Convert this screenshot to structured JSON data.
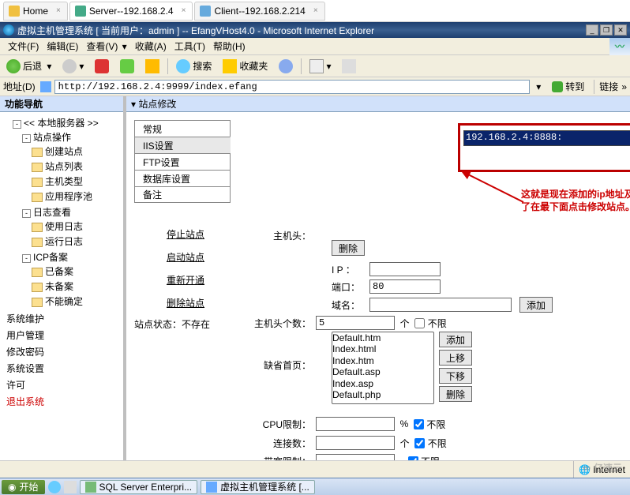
{
  "top_tabs": {
    "home": "Home",
    "server": "Server--192.168.2.4",
    "client": "Client--192.168.2.214"
  },
  "window_title": "虚拟主机管理系统 [ 当前用户：admin ] -- EfangVHost4.0 - Microsoft Internet Explorer",
  "menu": {
    "file": "文件(F)",
    "edit": "编辑(E)",
    "view": "查看(V)",
    "fav": "收藏(A)",
    "tools": "工具(T)",
    "help": "帮助(H)"
  },
  "toolbar": {
    "back": "后退",
    "search": "搜索",
    "fav": "收藏夹"
  },
  "addr": {
    "label": "地址(D)",
    "value": "http://192.168.2.4:9999/index.efang",
    "go": "转到",
    "links": "链接"
  },
  "left": {
    "title": "功能导航",
    "root": "<< 本地服务器 >>",
    "site_ops": "站点操作",
    "create_site": "创建站点",
    "site_list": "站点列表",
    "host_type": "主机类型",
    "app_pool": "应用程序池",
    "log": "日志查看",
    "log_use": "使用日志",
    "log_run": "运行日志",
    "icp": "ICP备案",
    "icp_done": "已备案",
    "icp_undone": "未备案",
    "icp_unknown": "不能确定",
    "sys_maint": "系统维护",
    "user_mgmt": "用户管理",
    "change_pwd": "修改密码",
    "sys_set": "系统设置",
    "license": "许可",
    "logout": "退出系统"
  },
  "right": {
    "title": "站点修改",
    "tabs": {
      "general": "常规",
      "iis": "IIS设置",
      "ftp": "FTP设置",
      "db": "数据库设置",
      "note": "备注"
    },
    "actions": {
      "stop": "停止站点",
      "start": "启动站点",
      "reopen": "重新开通",
      "delete": "删除站点"
    },
    "status_label": "站点状态：",
    "status_value": "不存在",
    "annotation": "这就是现在添加的ip地址及端口，修改完成后最后别忘记了在最下面点击修改站点。",
    "host_entry": "192.168.2.4:8888:",
    "labels": {
      "hosthead": "主机头：",
      "ip": "I P ：",
      "port": "端口：",
      "domain": "域名：",
      "hostcount": "主机头个数：",
      "unit": "个",
      "unlimited": "不限",
      "default": "缺省首页：",
      "cpu": "CPU限制：",
      "pct": "%",
      "conn": "连接数：",
      "bw": "带宽限制："
    },
    "btns": {
      "delete": "删除",
      "add": "添加",
      "add2": "添加",
      "up": "上移",
      "down": "下移",
      "del2": "删除"
    },
    "values": {
      "ip": "",
      "port": "80",
      "domain": "",
      "hostcount": "5",
      "cpu": "",
      "conn": "",
      "bw": ""
    },
    "defaults": [
      "Default.htm",
      "Index.html",
      "Index.htm",
      "Default.asp",
      "Index.asp",
      "Default.php"
    ]
  },
  "statusbar": {
    "internet": "Internet"
  },
  "taskbar": {
    "start": "开始",
    "sql": "SQL Server Enterpri...",
    "vh": "虚拟主机管理系统 [..."
  },
  "watermark": "亿速云"
}
